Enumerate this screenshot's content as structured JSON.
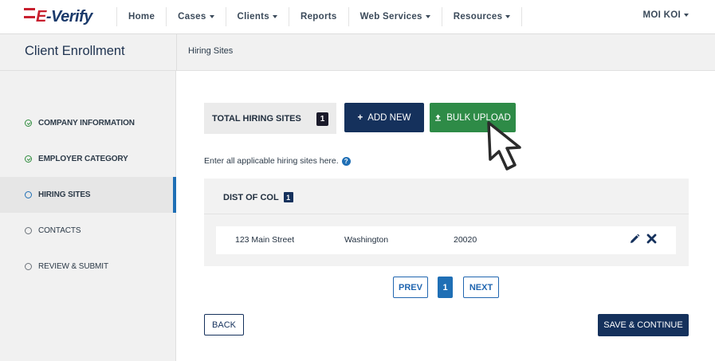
{
  "logo": {
    "prefix": "E",
    "text": "-Verify"
  },
  "nav": {
    "items": [
      {
        "label": "Home",
        "dropdown": false
      },
      {
        "label": "Cases",
        "dropdown": true
      },
      {
        "label": "Clients",
        "dropdown": true
      },
      {
        "label": "Reports",
        "dropdown": false
      },
      {
        "label": "Web Services",
        "dropdown": true
      },
      {
        "label": "Resources",
        "dropdown": true
      }
    ],
    "user": "MOI KOI"
  },
  "header": {
    "title": "Client Enrollment",
    "breadcrumb": "Hiring Sites"
  },
  "sidebar": {
    "steps": [
      {
        "label": "COMPANY INFORMATION",
        "state": "done"
      },
      {
        "label": "EMPLOYER CATEGORY",
        "state": "done"
      },
      {
        "label": "HIRING SITES",
        "state": "active"
      },
      {
        "label": "CONTACTS",
        "state": "todo"
      },
      {
        "label": "REVIEW & SUBMIT",
        "state": "todo"
      }
    ]
  },
  "main": {
    "total_label": "TOTAL HIRING SITES",
    "total_count": "1",
    "add_new_label": "ADD NEW",
    "bulk_upload_label": "BULK UPLOAD",
    "helper_text": "Enter all applicable hiring sites here.",
    "help_glyph": "?",
    "state_group": {
      "name": "DIST OF COL",
      "count": "1"
    },
    "sites": [
      {
        "street": "123 Main Street",
        "city": "Washington",
        "zip": "20020"
      }
    ],
    "pager": {
      "prev": "PREV",
      "current": "1",
      "next": "NEXT"
    },
    "back_label": "BACK",
    "save_label": "SAVE & CONTINUE"
  },
  "colors": {
    "navy": "#15315c",
    "green": "#2e8b47",
    "blue": "#1f6fb5",
    "red": "#c8202f"
  }
}
